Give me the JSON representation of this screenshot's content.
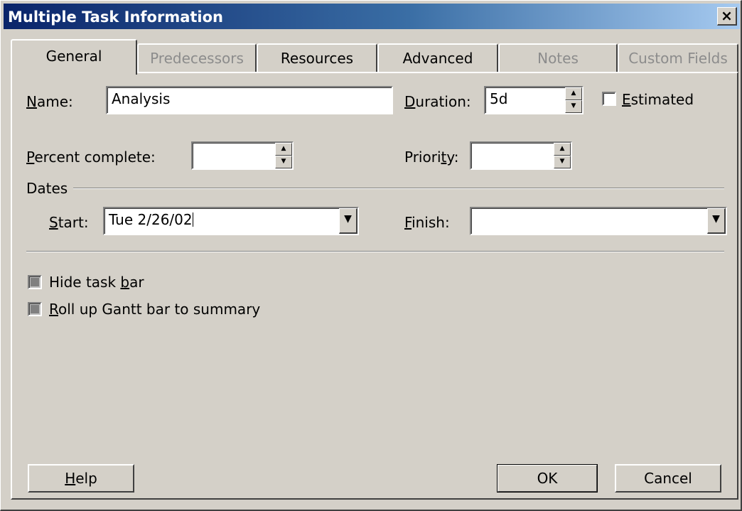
{
  "window": {
    "title": "Multiple Task Information",
    "close_label": "×"
  },
  "tabs": [
    {
      "label": "General",
      "active": true,
      "enabled": true
    },
    {
      "label": "Predecessors",
      "active": false,
      "enabled": false
    },
    {
      "label": "Resources",
      "active": false,
      "enabled": true
    },
    {
      "label": "Advanced",
      "active": false,
      "enabled": true
    },
    {
      "label": "Notes",
      "active": false,
      "enabled": false
    },
    {
      "label": "Custom Fields",
      "active": false,
      "enabled": false
    }
  ],
  "form": {
    "name": {
      "label_u": "N",
      "label_rest": "ame:",
      "value": "Analysis"
    },
    "duration": {
      "label_u": "D",
      "label_rest": "uration:",
      "value": "5d"
    },
    "estimated": {
      "label_u": "E",
      "label_rest": "stimated",
      "checked": false
    },
    "percent_complete": {
      "label_u": "P",
      "label_rest": "ercent complete:",
      "value": ""
    },
    "priority": {
      "label_pre": "Priori",
      "label_u": "t",
      "label_rest": "y:",
      "value": ""
    },
    "dates_group": "Dates",
    "start": {
      "label_u": "S",
      "label_rest": "tart:",
      "value": "Tue 2/26/02"
    },
    "finish": {
      "label_u": "F",
      "label_rest": "inish:",
      "value": ""
    },
    "hide_task_bar": {
      "label_pre": "Hide task ",
      "label_u": "b",
      "label_rest": "ar",
      "state": "indeterminate"
    },
    "rollup": {
      "label_u": "R",
      "label_rest": "oll up Gantt bar to summary",
      "state": "indeterminate"
    }
  },
  "buttons": {
    "help": {
      "label_u": "H",
      "label_rest": "elp"
    },
    "ok": "OK",
    "cancel": "Cancel"
  },
  "icons": {
    "spin_up": "▲",
    "spin_down": "▼",
    "dropdown": "▼"
  }
}
